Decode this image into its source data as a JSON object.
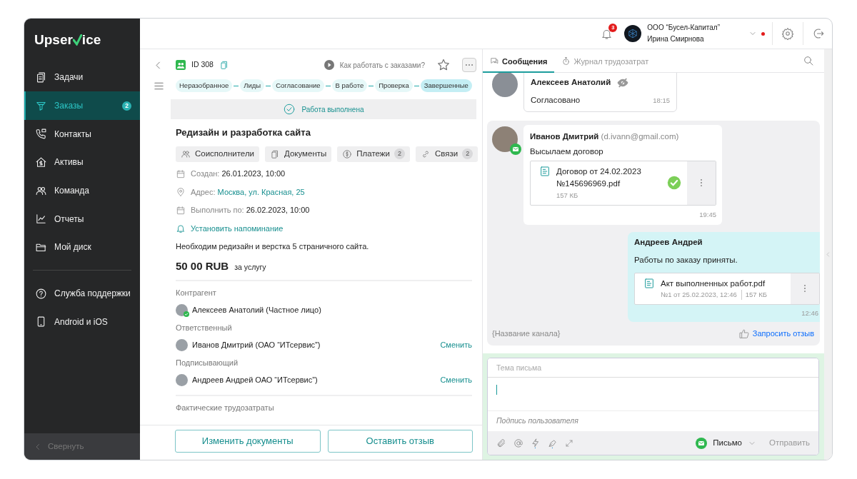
{
  "logo": {
    "before": "Upser",
    "after": "ice"
  },
  "sidebar": {
    "items": [
      {
        "label": "Задачи",
        "selected": false
      },
      {
        "label": "Заказы",
        "selected": true,
        "badge": "2"
      },
      {
        "label": "Контакты",
        "selected": false
      },
      {
        "label": "Активы",
        "selected": false
      },
      {
        "label": "Команда",
        "selected": false
      },
      {
        "label": "Отчеты",
        "selected": false
      },
      {
        "label": "Мой диск",
        "selected": false
      }
    ],
    "support_items": [
      {
        "label": "Служба поддержки"
      },
      {
        "label": "Android и iOS"
      }
    ],
    "collapse": "Свернуть"
  },
  "header": {
    "notifications": "3",
    "company": "ООО “Бусел-Капитал”",
    "user": "Ирина Смирнова"
  },
  "order": {
    "id": "ID 308",
    "help_link": "Как работать с заказами?",
    "stages": [
      {
        "label": "Неразобранное",
        "selected": false
      },
      {
        "label": "Лиды",
        "selected": false
      },
      {
        "label": "Согласование",
        "selected": false
      },
      {
        "label": "В работе",
        "selected": false
      },
      {
        "label": "Проверка",
        "selected": false
      },
      {
        "label": "Завершенные",
        "selected": true
      }
    ],
    "status": "Работа выполнена",
    "title": "Редизайн и разработка сайта",
    "actions": [
      {
        "label": "Соисполнители"
      },
      {
        "label": "Документы"
      },
      {
        "label": "Платежи",
        "count": "2"
      },
      {
        "label": "Связи",
        "count": "2"
      }
    ],
    "fields": [
      {
        "kind": "date",
        "label": "Создан:",
        "value": "26.01.2023, 10:00"
      },
      {
        "kind": "address",
        "label": "Адрес:",
        "value": "Москва, ул. Красная, 25"
      },
      {
        "kind": "date",
        "label": "Выполнить по:",
        "value": "26.02.2023, 10:00"
      }
    ],
    "reminder": "Установить напоминание",
    "description": "Необходим редизайн и верстка 5 страничного сайта.",
    "price": "50 00 RUB",
    "price_note": "за услугу",
    "people": [
      {
        "role": "Контрагент",
        "name": "Алексеев Анатолий (Частное лицо)",
        "verified": true
      },
      {
        "role": "Ответственный",
        "name": "Иванов Дмитрий (ОАО “ИТсервис”)",
        "verified": false,
        "action": "Сменить"
      },
      {
        "role": "Подписывающий",
        "name": "Андреев Андрей ОАО “ИТсервис”)",
        "verified": false,
        "action": "Сменить"
      }
    ],
    "labor_label": "Фактические трудозатраты",
    "buttons": [
      "Изменить документы",
      "Оставить отзыв"
    ]
  },
  "chat": {
    "tabs": [
      {
        "label": "Сообщения",
        "selected": true
      },
      {
        "label": "Журнал трудозатрат",
        "selected": false
      }
    ],
    "first_message": {
      "author": "Алексеев Анатолий",
      "hidden": true,
      "text": "Согласовано",
      "time": "18:15"
    },
    "thread": {
      "messages": [
        {
          "kind": "incoming",
          "author": "Иванов Дмитрий",
          "email": "(d.ivann@gmail.com)",
          "via_email": true,
          "text": "Высылаем договор",
          "file": {
            "name": "Договор от 24.02.2023 №145696969.pdf",
            "meta": [
              "157 КБ"
            ],
            "approved": true
          },
          "time": "19:45"
        },
        {
          "kind": "outgoing",
          "author": "Андреев Андрей",
          "text": "Работы по заказу приняты.",
          "file": {
            "name": "Акт выполненных работ.pdf",
            "meta": [
              "№1 от 25.02.2023, 12:46",
              "157 КБ"
            ],
            "approved": false
          },
          "time": "12:46"
        }
      ],
      "channel": "{Название канала}",
      "request_review": "Запросить отзыв"
    },
    "composer": {
      "subject_placeholder": "Тема письма",
      "signature": "Подпись пользователя",
      "channel": "Письмо",
      "send": "Отправить"
    }
  }
}
